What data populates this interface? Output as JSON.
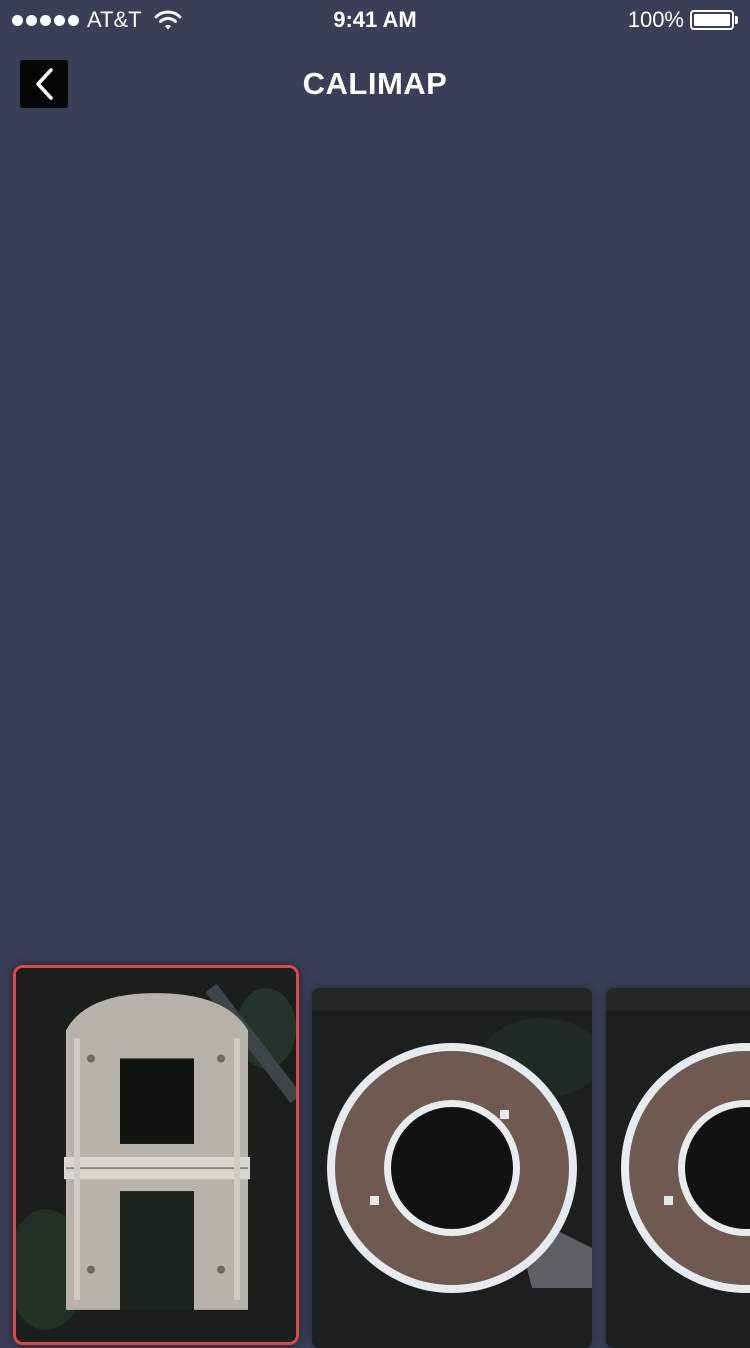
{
  "status_bar": {
    "carrier": "AT&T",
    "time": "9:41 AM",
    "battery_percent": "100%",
    "signal_icon": "signal-dots-icon",
    "wifi_icon": "wifi-icon",
    "battery_icon": "battery-icon",
    "battery_level": 1.0
  },
  "nav": {
    "title": "CALIMAP",
    "back_icon": "chevron-left-icon"
  },
  "carousel": {
    "selected_index": 0,
    "items": [
      {
        "name": "aerial-building-a"
      },
      {
        "name": "aerial-building-ring"
      },
      {
        "name": "aerial-building-ring"
      }
    ]
  },
  "colors": {
    "background": "#3a3f57",
    "back_button": "#050505",
    "selected_border": "#e04848",
    "text": "#ffffff"
  }
}
